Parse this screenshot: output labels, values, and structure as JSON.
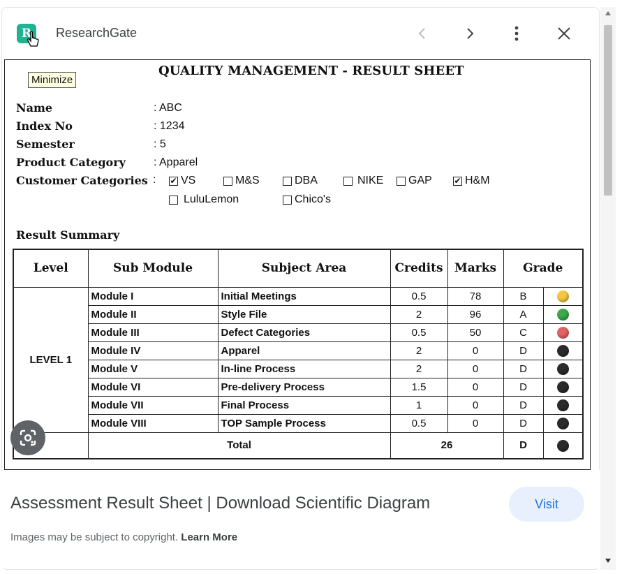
{
  "header": {
    "site_name": "ResearchGate",
    "logo_text": "R",
    "icons": [
      "chevron-left-icon",
      "chevron-right-icon",
      "more-vert-icon",
      "close-icon"
    ]
  },
  "tooltip": "Minimize",
  "document": {
    "title": "QUALITY MANAGEMENT  - RESULT SHEET",
    "fields": [
      {
        "label": "Name",
        "value": ": ABC"
      },
      {
        "label": "Index No",
        "value": ": 1234"
      },
      {
        "label": "Semester",
        "value": ": 5"
      },
      {
        "label": "Product Category",
        "value": ": Apparel"
      }
    ],
    "customer_label": "Customer Categories",
    "customer_colon": ":",
    "customers": [
      {
        "name": "VS",
        "checked": true
      },
      {
        "name": "M&S",
        "checked": false
      },
      {
        "name": "DBA",
        "checked": false
      },
      {
        "name": "NIKE",
        "checked": false
      },
      {
        "name": "GAP",
        "checked": false
      },
      {
        "name": "H&M",
        "checked": true
      },
      {
        "name": "LuluLemon",
        "checked": false
      },
      {
        "name": "Chico's",
        "checked": false
      }
    ],
    "summary_label": "Result Summary",
    "table": {
      "headers": [
        "Level",
        "Sub Module",
        "Subject Area",
        "Credits",
        "Marks",
        "Grade"
      ],
      "level": "LEVEL 1",
      "rows": [
        {
          "module": "Module I",
          "subject": "Initial Meetings",
          "credits": "0.5",
          "marks": "78",
          "grade": "B",
          "dot": "#f5c842"
        },
        {
          "module": "Module II",
          "subject": "Style File",
          "credits": "2",
          "marks": "96",
          "grade": "A",
          "dot": "#3caa4c"
        },
        {
          "module": "Module III",
          "subject": "Defect Categories",
          "credits": "0.5",
          "marks": "50",
          "grade": "C",
          "dot": "#e06464"
        },
        {
          "module": "Module IV",
          "subject": "Apparel",
          "credits": "2",
          "marks": "0",
          "grade": "D",
          "dot": "#2b2b2b"
        },
        {
          "module": "Module V",
          "subject": "In-line Process",
          "credits": "2",
          "marks": "0",
          "grade": "D",
          "dot": "#2b2b2b"
        },
        {
          "module": "Module VI",
          "subject": "Pre-delivery Process",
          "credits": "1.5",
          "marks": "0",
          "grade": "D",
          "dot": "#2b2b2b"
        },
        {
          "module": "Module VII",
          "subject": "Final Process",
          "credits": "1",
          "marks": "0",
          "grade": "D",
          "dot": "#2b2b2b"
        },
        {
          "module": "Module VIII",
          "subject": "TOP Sample Process",
          "credits": "0.5",
          "marks": "0",
          "grade": "D",
          "dot": "#2b2b2b"
        }
      ],
      "total": {
        "label": "Total",
        "value": "26",
        "grade": "D",
        "dot": "#2b2b2b"
      }
    }
  },
  "footer": {
    "title": "Assessment Result Sheet | Download Scientific Diagram",
    "visit_label": "Visit",
    "copyright_text": "Images may be subject to copyright.",
    "learn_more": "Learn More"
  },
  "lens_icon": "google-lens-icon"
}
